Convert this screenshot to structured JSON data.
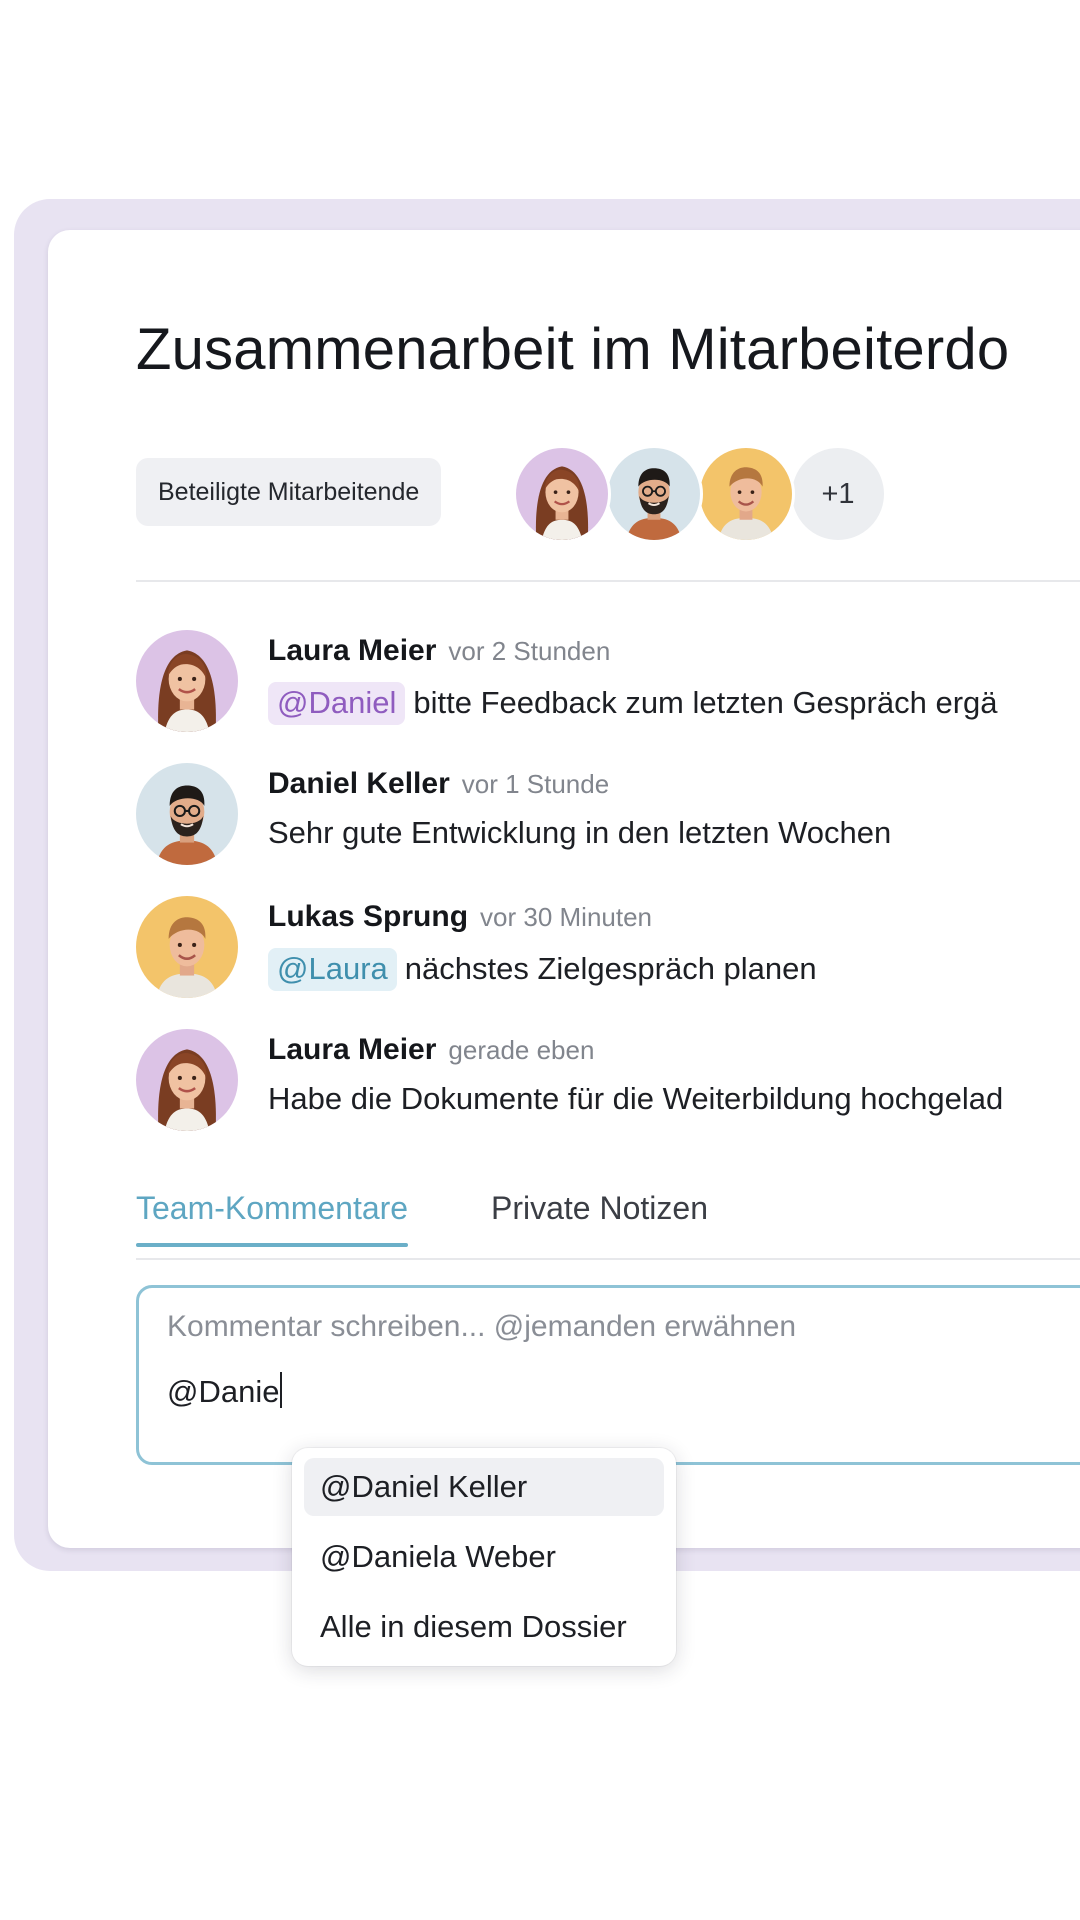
{
  "card": {
    "title": "Zusammenarbeit im Mitarbeiterdo"
  },
  "participants": {
    "label": "Beteiligte Mitarbeitende",
    "more_count": "+1",
    "avatars": [
      "laura-meier",
      "daniel-keller",
      "lukas-sprung"
    ]
  },
  "comments": [
    {
      "name": "Laura Meier",
      "time": "vor 2 Stunden",
      "mention": "@Daniel",
      "text": "bitte Feedback zum letzten Gespräch ergä"
    },
    {
      "name": "Daniel Keller",
      "time": "vor 1 Stunde",
      "mention": "",
      "text": "Sehr gute Entwicklung in den letzten Wochen"
    },
    {
      "name": "Lukas Sprung",
      "time": "vor 30 Minuten",
      "mention": "@Laura",
      "text": "nächstes Zielgespräch planen"
    },
    {
      "name": "Laura Meier",
      "time": "gerade eben",
      "mention": "",
      "text": "Habe die Dokumente für die Weiterbildung hochgelad"
    }
  ],
  "tabs": {
    "team": "Team-Kommentare",
    "private": "Private Notizen",
    "active": "team"
  },
  "editor": {
    "placeholder": "Kommentar schreiben... @jemanden erwähnen",
    "value": "@Danie"
  },
  "mention_suggestions": [
    {
      "label": "@Daniel Keller",
      "highlighted": true
    },
    {
      "label": "@Daniela Weber",
      "highlighted": false
    },
    {
      "label": "Alle in diesem Dossier",
      "highlighted": false
    }
  ],
  "colors": {
    "accent": "#6bafc8",
    "mention_purple_bg": "#efe6f7",
    "mention_purple_text": "#8f5cbf",
    "mention_blue_bg": "#e2f0f6",
    "mention_blue_text": "#3f8fad",
    "frame_lavender": "#e8e3f2"
  }
}
